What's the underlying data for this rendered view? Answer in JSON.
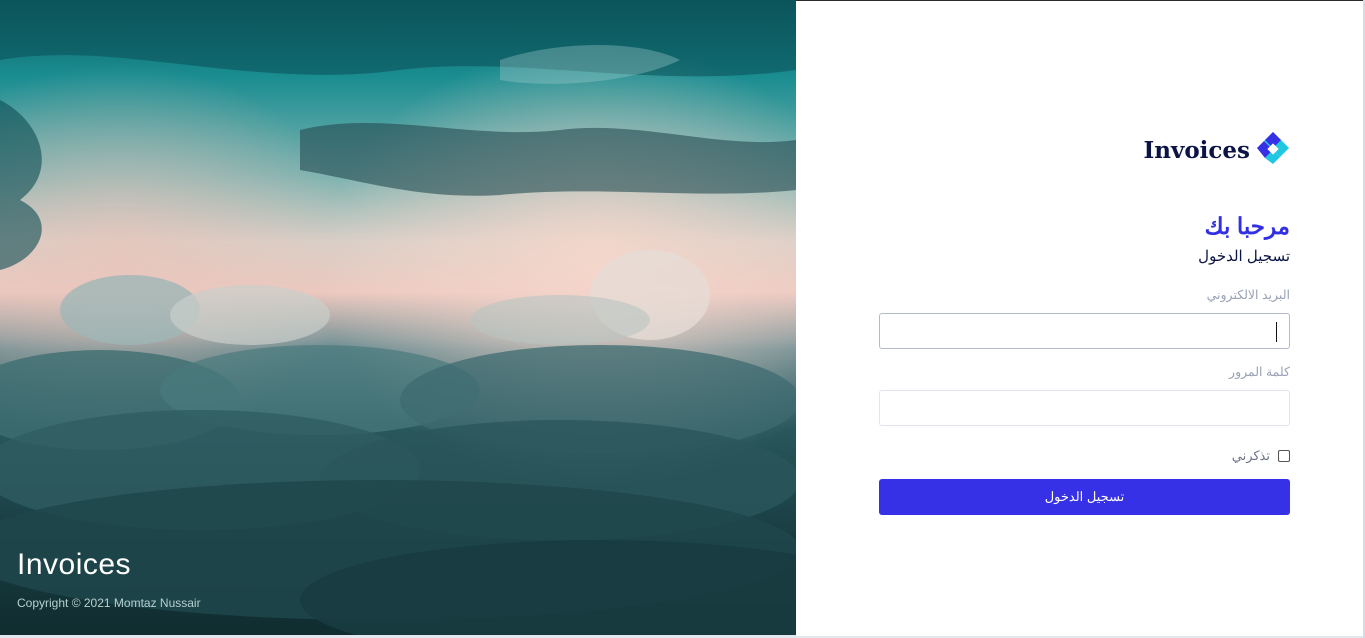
{
  "hero": {
    "title": "Invoices",
    "copyright": "Copyright © 2021 Momtaz Nussair"
  },
  "brand": {
    "name": "Invoices",
    "logo_icon": "diamond-logo-icon",
    "logo_colors": [
      "#1fc8e0",
      "#3630e6"
    ]
  },
  "form": {
    "welcome": "مرحبا بك",
    "subtitle": "تسجيل الدخول",
    "email_label": "البريد الالكتروني",
    "email_value": "",
    "password_label": "كلمة المرور",
    "password_value": "",
    "remember_label": "تذكرني",
    "remember_checked": false,
    "submit_label": "تسجيل الدخول"
  },
  "colors": {
    "accent": "#3630e6",
    "heading": "#0b1444",
    "label": "#9aa1b5"
  }
}
